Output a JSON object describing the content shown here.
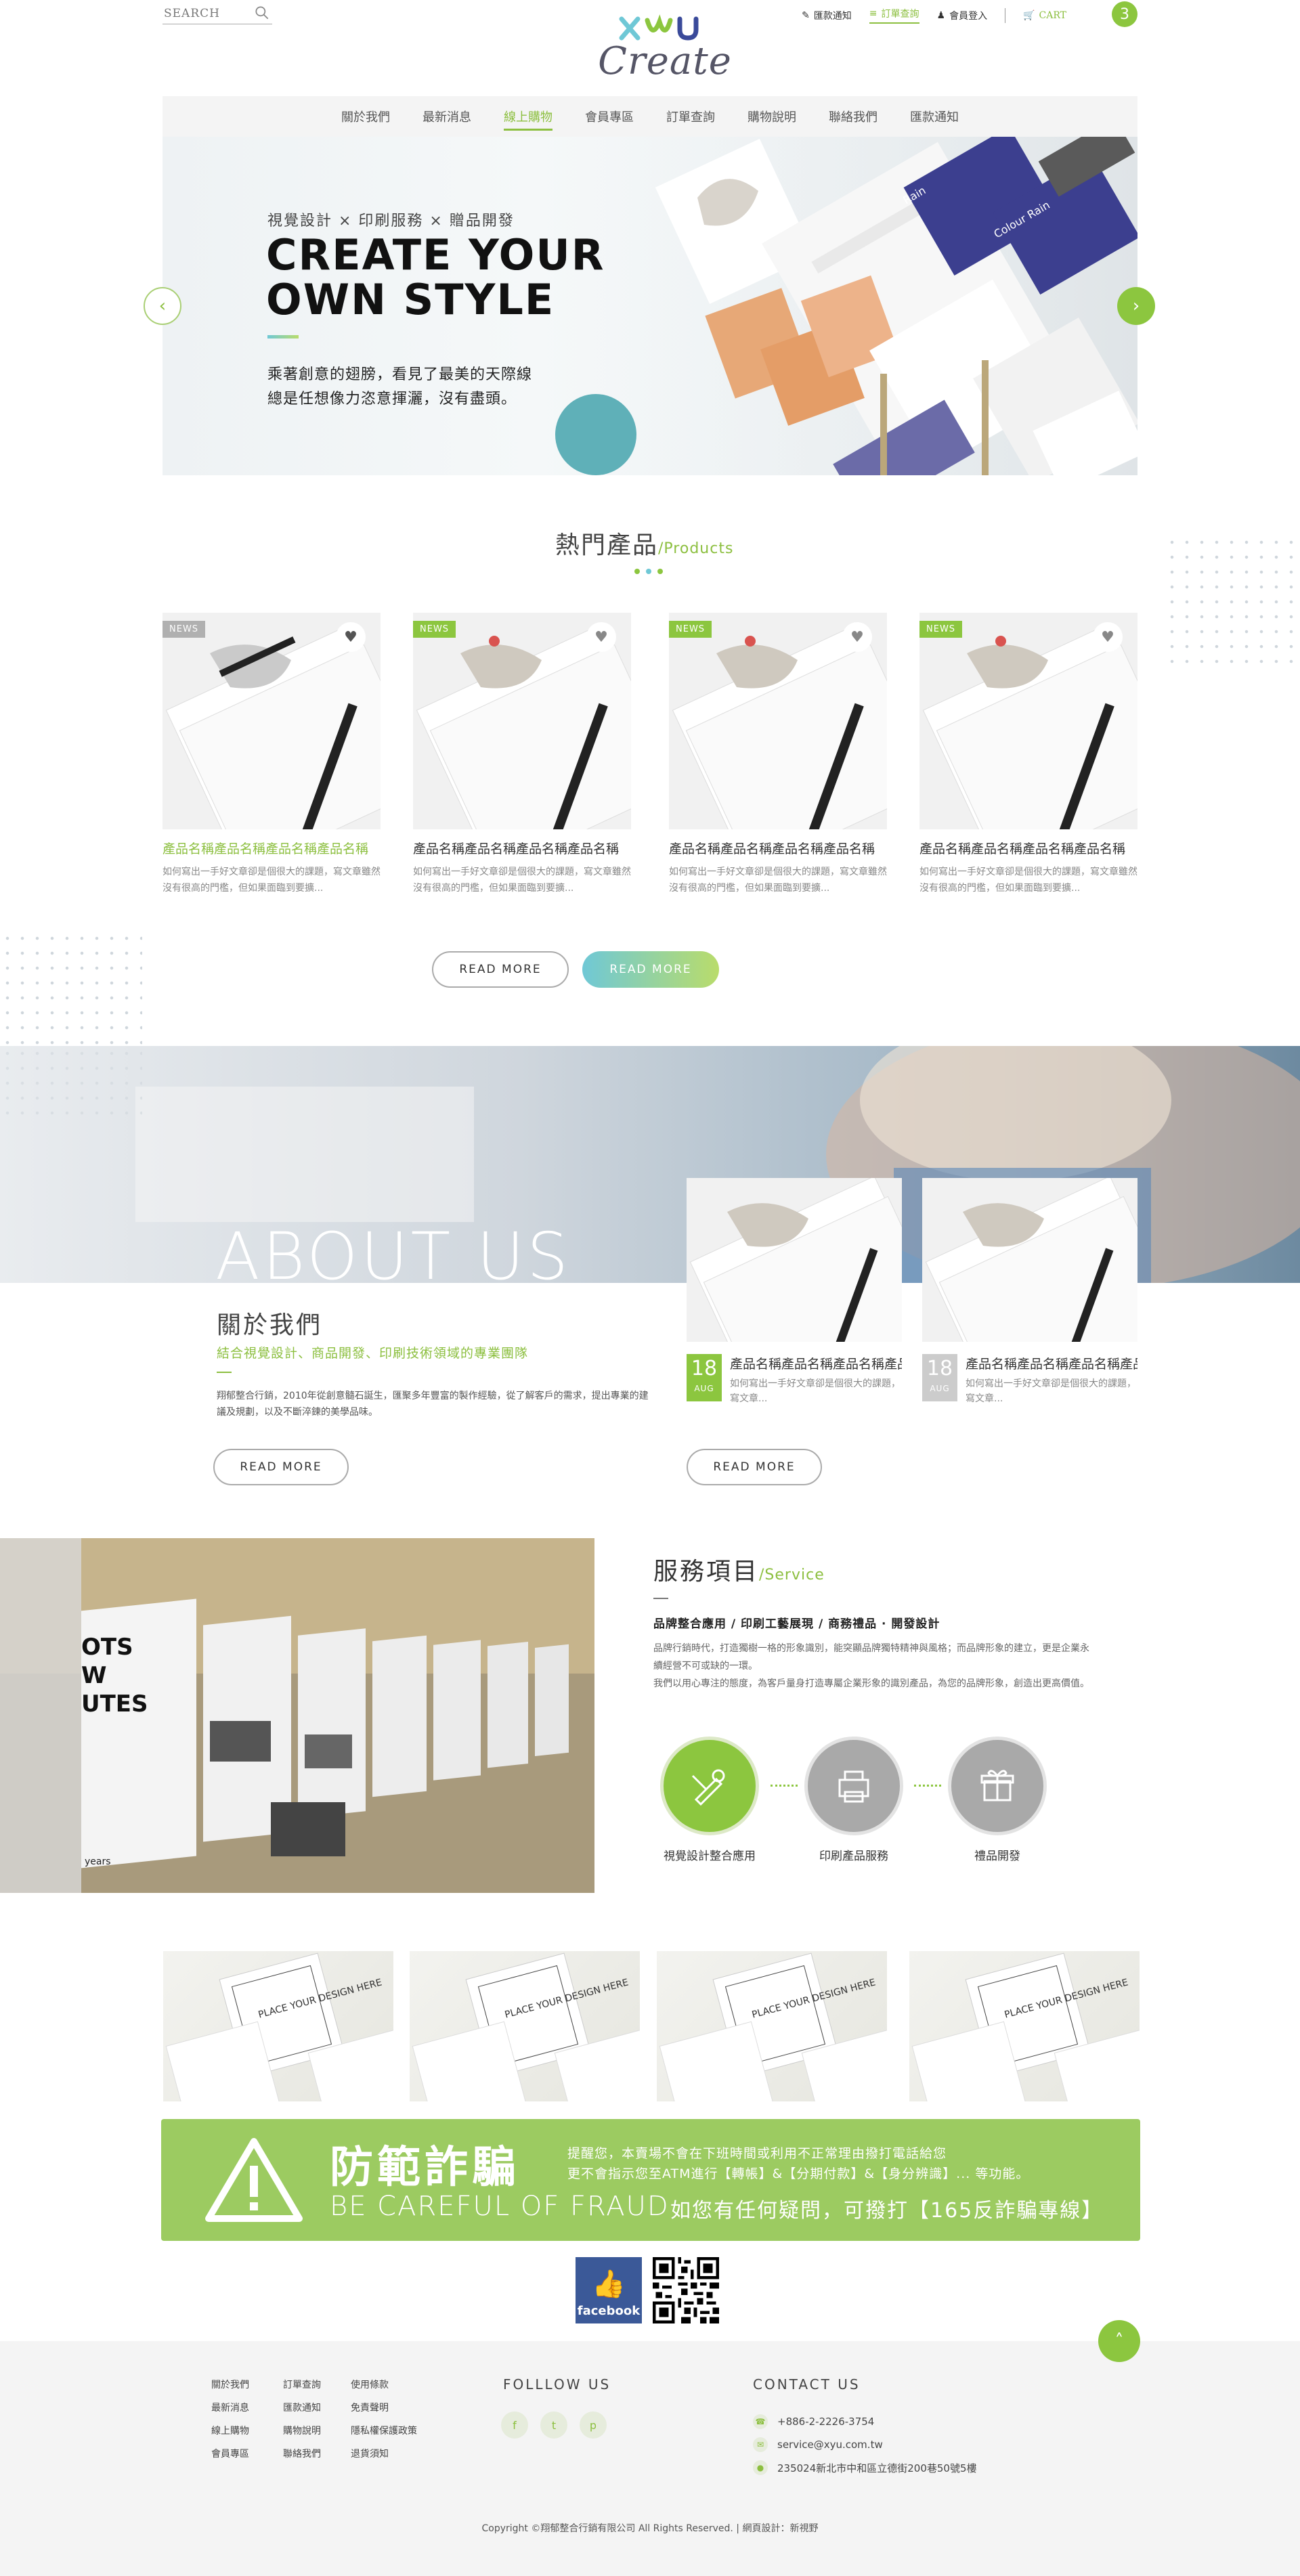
{
  "header": {
    "search_placeholder": "SEARCH",
    "logo_text": "Create",
    "top_links": [
      "匯款通知",
      "訂單查詢",
      "會員登入"
    ],
    "cart_label": "CART",
    "cart_count": "3"
  },
  "nav": [
    "關於我們",
    "最新消息",
    "線上購物",
    "會員專區",
    "訂單查詢",
    "購物說明",
    "聯絡我們",
    "匯款通知"
  ],
  "hero": {
    "tagline": "視覺設計 × 印刷服務 × 贈品開發",
    "title_line1": "CREATE YOUR",
    "title_line2": "OWN STYLE",
    "desc_line1": "乘著創意的翅膀，看見了最美的天際線",
    "desc_line2": "總是任想像力恣意揮灑，沒有盡頭。",
    "prev": "‹",
    "next": "›",
    "card_words": [
      "Rain",
      "Colour Rain"
    ]
  },
  "products": {
    "title": "熱門產品",
    "title_en": "/Products",
    "items": [
      {
        "badge": "NEWS",
        "name": "產品名稱產品名稱產品名稱產品名稱",
        "desc": "如何寫出一手好文章卻是個很大的課題，寫文章雖然沒有很高的門檻，但如果面臨到要擴..."
      },
      {
        "badge": "NEWS",
        "name": "產品名稱產品名稱產品名稱產品名稱",
        "desc": "如何寫出一手好文章卻是個很大的課題，寫文章雖然沒有很高的門檻，但如果面臨到要擴..."
      },
      {
        "badge": "NEWS",
        "name": "產品名稱產品名稱產品名稱產品名稱",
        "desc": "如何寫出一手好文章卻是個很大的課題，寫文章雖然沒有很高的門檻，但如果面臨到要擴..."
      },
      {
        "badge": "NEWS",
        "name": "產品名稱產品名稱產品名稱產品名稱",
        "desc": "如何寫出一手好文章卻是個很大的課題，寫文章雖然沒有很高的門檻，但如果面臨到要擴..."
      }
    ],
    "btn_outline": "READ MORE",
    "btn_grad": "READ MORE"
  },
  "about": {
    "big": "ABOUT US",
    "title": "關於我們",
    "subtitle": "結合視覺設計、商品開發、印刷技術領域的專業團隊",
    "desc": "翔郁整合行銷，2010年從創意髓石誕生，匯聚多年豐富的製作經驗，從了解客戶的需求，提出專業的建議及規劃，以及不斷淬鍊的美學品味。",
    "btn": "READ MORE",
    "news": [
      {
        "day": "18",
        "month": "AUG",
        "title": "產品名稱產品名稱產品名稱產品名稱",
        "desc": "如何寫出一手好文章卻是個很大的課題，寫文章..."
      },
      {
        "day": "18",
        "month": "AUG",
        "title": "產品名稱產品名稱產品名稱產品名稱",
        "desc": "如何寫出一手好文章卻是個很大的課題，寫文章..."
      }
    ],
    "news_btn": "READ MORE"
  },
  "service": {
    "title": "服務項目",
    "title_en": "/Service",
    "heading": "品牌整合應用 / 印刷工藝展現 / 商務禮品 · 開發設計",
    "p1": "品牌行銷時代，打造獨樹一格的形象識別，能突顯品牌獨特精神與風格；而品牌形象的建立，更是企業永續經營不可或缺的一環。",
    "p2": "我們以用心專注的態度，為客戶量身打造專屬企業形象的識別產品，為您的品牌形象，創造出更高價值。",
    "items": [
      "視覺設計整合應用",
      "印刷產品服務",
      "禮品開發"
    ],
    "photo_text": [
      "OTS",
      "W",
      "UTES",
      "years"
    ]
  },
  "gallery": {
    "card_text": "PLACE YOUR DESIGN HERE"
  },
  "fraud": {
    "title_zh": "防範詐騙",
    "title_en": "BE CAREFUL OF FRAUD",
    "line1": "提醒您，本賣場不會在下班時間或利用不正常理由撥打電話給您",
    "line2": "更不會指示您至ATM進行【轉帳】&【分期付款】&【身分辨識】... 等功能。",
    "line3": "如您有任何疑問，可撥打【165反詐騙專線】"
  },
  "facebook": "facebook",
  "footer": {
    "links": [
      "關於我們",
      "訂單查詢",
      "使用條款",
      "最新消息",
      "匯款通知",
      "免責聲明",
      "線上購物",
      "購物說明",
      "隱私權保護政策",
      "會員專區",
      "聯絡我們",
      "退貨須知"
    ],
    "follow_title": "FOLLLOW US",
    "social": [
      "f",
      "t",
      "p"
    ],
    "contact_title": "CONTACT US",
    "phone": "+886-2-2226-3754",
    "email": "service@xyu.com.tw",
    "address": "235024新北市中和區立德街200巷50號5樓",
    "copyright": "Copyright ©翔郁整合行銷有限公司  All Rights Reserved.  |  網頁設計：新視野",
    "gotop": "˄"
  },
  "colors": {
    "accent": "#8cc63f",
    "teal": "#6fc8d6",
    "text": "#333333"
  }
}
